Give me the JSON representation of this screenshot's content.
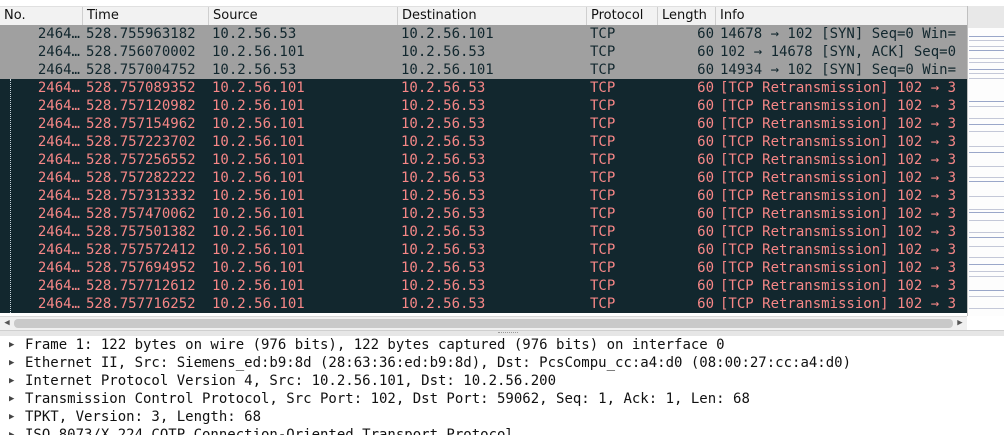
{
  "packet_list": {
    "columns": {
      "no": "No.",
      "time": "Time",
      "source": "Source",
      "destination": "Destination",
      "protocol": "Protocol",
      "length": "Length",
      "info": "Info"
    },
    "rows": [
      {
        "no": "2464…",
        "time": "528.755963182",
        "source": "10.2.56.53",
        "destination": "10.2.56.101",
        "protocol": "TCP",
        "length": "60",
        "info": "14678 → 102 [SYN] Seq=0 Win=",
        "style": "normal"
      },
      {
        "no": "2464…",
        "time": "528.756070002",
        "source": "10.2.56.101",
        "destination": "10.2.56.53",
        "protocol": "TCP",
        "length": "60",
        "info": "102 → 14678 [SYN, ACK] Seq=0",
        "style": "normal"
      },
      {
        "no": "2464…",
        "time": "528.757004752",
        "source": "10.2.56.53",
        "destination": "10.2.56.101",
        "protocol": "TCP",
        "length": "60",
        "info": "14934 → 102 [SYN] Seq=0 Win=",
        "style": "normal"
      },
      {
        "no": "2464…",
        "time": "528.757089352",
        "source": "10.2.56.101",
        "destination": "10.2.56.53",
        "protocol": "TCP",
        "length": "60",
        "info": "[TCP Retransmission] 102 → 3",
        "style": "retrans"
      },
      {
        "no": "2464…",
        "time": "528.757120982",
        "source": "10.2.56.101",
        "destination": "10.2.56.53",
        "protocol": "TCP",
        "length": "60",
        "info": "[TCP Retransmission] 102 → 3",
        "style": "retrans"
      },
      {
        "no": "2464…",
        "time": "528.757154962",
        "source": "10.2.56.101",
        "destination": "10.2.56.53",
        "protocol": "TCP",
        "length": "60",
        "info": "[TCP Retransmission] 102 → 3",
        "style": "retrans"
      },
      {
        "no": "2464…",
        "time": "528.757223702",
        "source": "10.2.56.101",
        "destination": "10.2.56.53",
        "protocol": "TCP",
        "length": "60",
        "info": "[TCP Retransmission] 102 → 3",
        "style": "retrans"
      },
      {
        "no": "2464…",
        "time": "528.757256552",
        "source": "10.2.56.101",
        "destination": "10.2.56.53",
        "protocol": "TCP",
        "length": "60",
        "info": "[TCP Retransmission] 102 → 3",
        "style": "retrans"
      },
      {
        "no": "2464…",
        "time": "528.757282222",
        "source": "10.2.56.101",
        "destination": "10.2.56.53",
        "protocol": "TCP",
        "length": "60",
        "info": "[TCP Retransmission] 102 → 3",
        "style": "retrans"
      },
      {
        "no": "2464…",
        "time": "528.757313332",
        "source": "10.2.56.101",
        "destination": "10.2.56.53",
        "protocol": "TCP",
        "length": "60",
        "info": "[TCP Retransmission] 102 → 3",
        "style": "retrans"
      },
      {
        "no": "2464…",
        "time": "528.757470062",
        "source": "10.2.56.101",
        "destination": "10.2.56.53",
        "protocol": "TCP",
        "length": "60",
        "info": "[TCP Retransmission] 102 → 3",
        "style": "retrans"
      },
      {
        "no": "2464…",
        "time": "528.757501382",
        "source": "10.2.56.101",
        "destination": "10.2.56.53",
        "protocol": "TCP",
        "length": "60",
        "info": "[TCP Retransmission] 102 → 3",
        "style": "retrans"
      },
      {
        "no": "2464…",
        "time": "528.757572412",
        "source": "10.2.56.101",
        "destination": "10.2.56.53",
        "protocol": "TCP",
        "length": "60",
        "info": "[TCP Retransmission] 102 → 3",
        "style": "retrans"
      },
      {
        "no": "2464…",
        "time": "528.757694952",
        "source": "10.2.56.101",
        "destination": "10.2.56.53",
        "protocol": "TCP",
        "length": "60",
        "info": "[TCP Retransmission] 102 → 3",
        "style": "retrans"
      },
      {
        "no": "2464…",
        "time": "528.757712612",
        "source": "10.2.56.101",
        "destination": "10.2.56.53",
        "protocol": "TCP",
        "length": "60",
        "info": "[TCP Retransmission] 102 → 3",
        "style": "retrans"
      },
      {
        "no": "2464…",
        "time": "528.757716252",
        "source": "10.2.56.101",
        "destination": "10.2.56.53",
        "protocol": "TCP",
        "length": "60",
        "info": "[TCP Retransmission] 102 → 3",
        "style": "retrans"
      }
    ]
  },
  "scrollbar": {
    "left_arrow_icon": "chevron-left-icon",
    "right_arrow_icon": "chevron-right-icon"
  },
  "colors": {
    "normal_row_bg": "#a0a0a0",
    "normal_row_fg": "#12272e",
    "retrans_row_bg": "#12272e",
    "retrans_row_fg": "#f78787"
  },
  "details": {
    "expander_icon": "chevron-right-icon",
    "lines": [
      "Frame 1: 122 bytes on wire (976 bits), 122 bytes captured (976 bits) on interface 0",
      "Ethernet II, Src: Siemens_ed:b9:8d (28:63:36:ed:b9:8d), Dst: PcsCompu_cc:a4:d0 (08:00:27:cc:a4:d0)",
      "Internet Protocol Version 4, Src: 10.2.56.101, Dst: 10.2.56.200",
      "Transmission Control Protocol, Src Port: 102, Dst Port: 59062, Seq: 1, Ack: 1, Len: 68",
      "TPKT, Version: 3, Length: 68",
      "ISO 8073/X.224 COTP Connection-Oriented Transport Protocol"
    ]
  }
}
